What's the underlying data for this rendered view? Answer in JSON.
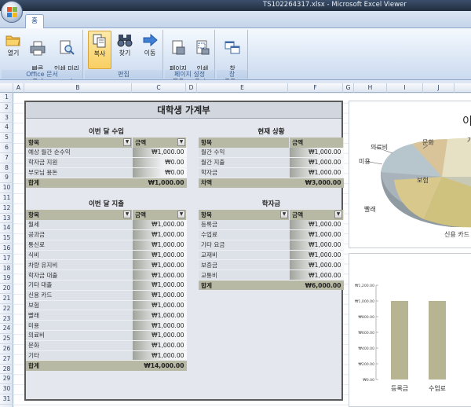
{
  "window": {
    "title": "TS102264317.xlsx - Microsoft Excel Viewer"
  },
  "tabs": [
    {
      "label": "홈"
    }
  ],
  "ribbon": {
    "groups": [
      {
        "label": "Office 문서",
        "buttons": [
          {
            "label": "열기"
          },
          {
            "label": "빠른\n인쇄"
          },
          {
            "label": "인쇄 미리\n보기"
          }
        ]
      },
      {
        "label": "편집",
        "buttons": [
          {
            "label": "복사"
          },
          {
            "label": "찾기"
          },
          {
            "label": "이동"
          }
        ]
      },
      {
        "label": "페이지 설정",
        "buttons": [
          {
            "label": "페이지\n설정"
          },
          {
            "label": "인쇄\n영역 ▾"
          }
        ]
      },
      {
        "label": "창",
        "buttons": [
          {
            "label": "창\n전환 ▾"
          }
        ]
      }
    ]
  },
  "grid": {
    "columns": [
      "A",
      "B",
      "C",
      "D",
      "E",
      "F",
      "G",
      "H",
      "I",
      "J"
    ],
    "rows": [
      "1",
      "2",
      "3",
      "4",
      "5",
      "6",
      "7",
      "8",
      "9",
      "10",
      "11",
      "12",
      "13",
      "14",
      "15",
      "16",
      "17",
      "18",
      "19",
      "20",
      "21",
      "22",
      "23",
      "24",
      "25",
      "26",
      "27",
      "28",
      "29",
      "30",
      "31"
    ]
  },
  "budget": {
    "title": "대학생 가계부",
    "income": {
      "title": "이번 달 수입",
      "headers": [
        "항목",
        "금액"
      ],
      "rows": [
        {
          "item": "예상 월간 순수익",
          "amount": "₩1,000.00"
        },
        {
          "item": "학자금 지원",
          "amount": "₩0.00"
        },
        {
          "item": "부모님 용돈",
          "amount": "₩0.00"
        }
      ],
      "total_label": "합계",
      "total": "₩1,000.00"
    },
    "status": {
      "title": "현재 상황",
      "headers": [
        "항목",
        "금액"
      ],
      "rows": [
        {
          "item": "월간 수익",
          "amount": "₩1,000.00"
        },
        {
          "item": "월간 지출",
          "amount": "₩1,000.00"
        },
        {
          "item": "학자금",
          "amount": "₩1,000.00"
        }
      ],
      "total_label": "차액",
      "total": "₩3,000.00"
    },
    "expense": {
      "title": "이번 달 지출",
      "headers": [
        "항목",
        "금액"
      ],
      "rows": [
        {
          "item": "월세",
          "amount": "₩1,000.00"
        },
        {
          "item": "공과금",
          "amount": "₩1,000.00"
        },
        {
          "item": "통신료",
          "amount": "₩1,000.00"
        },
        {
          "item": "식비",
          "amount": "₩1,000.00"
        },
        {
          "item": "차량 유지비",
          "amount": "₩1,000.00"
        },
        {
          "item": "학자금 대출",
          "amount": "₩1,000.00"
        },
        {
          "item": "기타 대출",
          "amount": "₩1,000.00"
        },
        {
          "item": "신용 카드",
          "amount": "₩1,000.00"
        },
        {
          "item": "보험",
          "amount": "₩1,000.00"
        },
        {
          "item": "빨래",
          "amount": "₩1,000.00"
        },
        {
          "item": "미용",
          "amount": "₩1,000.00"
        },
        {
          "item": "의료비",
          "amount": "₩1,000.00"
        },
        {
          "item": "문화",
          "amount": "₩1,000.00"
        },
        {
          "item": "기타",
          "amount": "₩1,000.00"
        }
      ],
      "total_label": "합계",
      "total": "₩14,000.00"
    },
    "tuition": {
      "title": "학자금",
      "headers": [
        "항목",
        "금액"
      ],
      "rows": [
        {
          "item": "등록금",
          "amount": "₩1,000.00"
        },
        {
          "item": "수업료",
          "amount": "₩1,000.00"
        },
        {
          "item": "기타 요금",
          "amount": "₩1,000.00"
        },
        {
          "item": "교재비",
          "amount": "₩1,000.00"
        },
        {
          "item": "보증금",
          "amount": "₩1,000.00"
        },
        {
          "item": "교통비",
          "amount": "₩1,000.00"
        }
      ],
      "total_label": "합계",
      "total": "₩6,000.00"
    }
  },
  "pie_chart": {
    "title_fragment": "이",
    "labels": [
      "문화",
      "의료비",
      "미용",
      "보험",
      "빨래",
      "신용 카드",
      "기"
    ]
  },
  "chart_data": {
    "type": "bar",
    "categories": [
      "등록금",
      "수업료"
    ],
    "values": [
      1000,
      1000
    ],
    "ylim": [
      0,
      1200
    ],
    "y_ticks": [
      "₩0.00",
      "₩200.00",
      "₩400.00",
      "₩600.00",
      "₩800.00",
      "₩1,000.00",
      "₩1,200.00"
    ],
    "bar_color": "#b7b491"
  },
  "colors": {
    "accent": "#15428b",
    "table_header": "#b7b9a5",
    "panel_bg": "#e4e7ed"
  }
}
